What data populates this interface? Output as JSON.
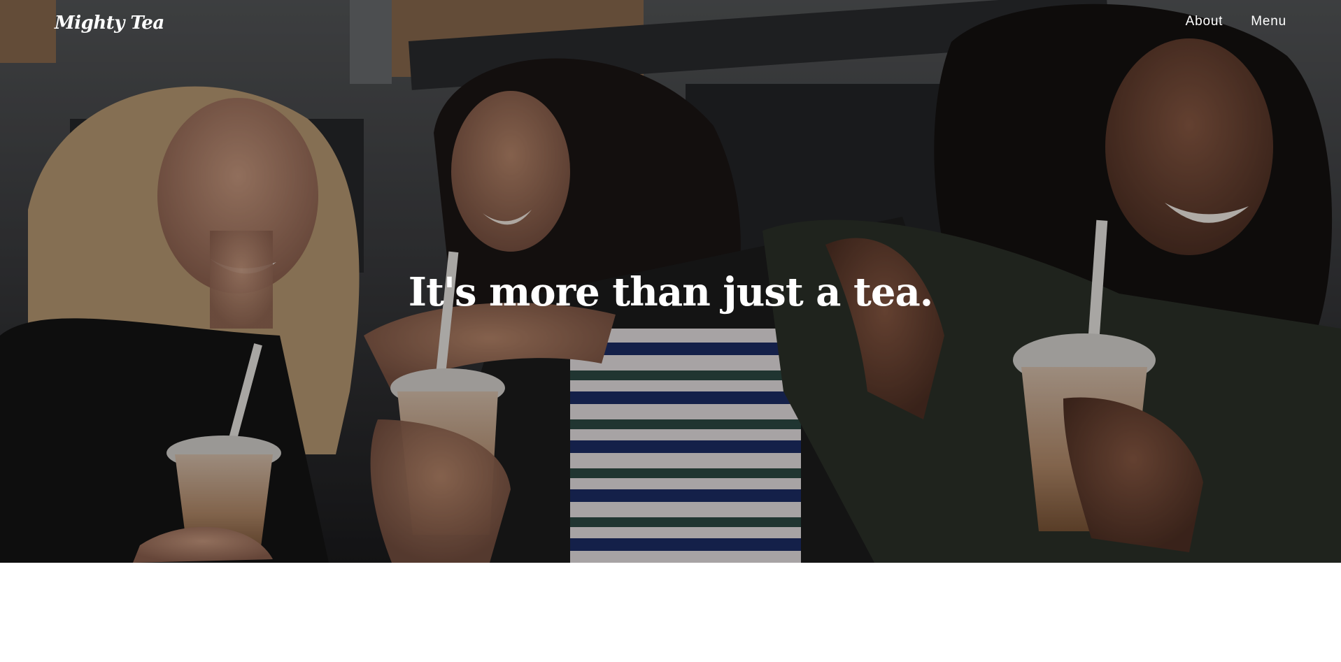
{
  "brand": {
    "name": "Mighty Tea"
  },
  "nav": {
    "items": [
      {
        "label": "About"
      },
      {
        "label": "Menu"
      }
    ]
  },
  "hero": {
    "headline": "It's more than just a tea."
  },
  "colors": {
    "text": "#ffffff",
    "page_background": "#ffffff",
    "overlay": "rgba(0,0,0,0.28)"
  }
}
